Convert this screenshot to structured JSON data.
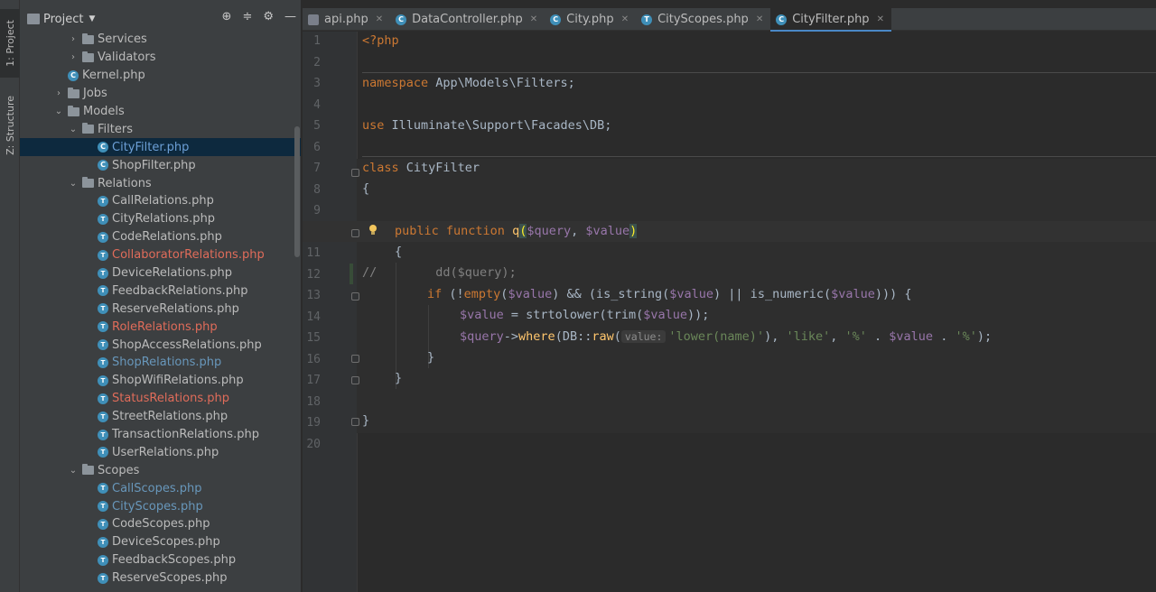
{
  "toolstrip": {
    "project_tab": "1: Project",
    "structure_tab": "Z: Structure"
  },
  "project_panel": {
    "title": "Project",
    "tools": [
      "crosshair-icon",
      "collapse-icon",
      "gear-icon",
      "minimize-icon"
    ],
    "tree": [
      {
        "label": "Services",
        "type": "folder",
        "depth": 3,
        "expanded": false
      },
      {
        "label": "Validators",
        "type": "folder",
        "depth": 3,
        "expanded": false
      },
      {
        "label": "Kernel.php",
        "type": "class",
        "depth": 3
      },
      {
        "label": "Jobs",
        "type": "folder",
        "depth": 2,
        "expanded": false
      },
      {
        "label": "Models",
        "type": "folder",
        "depth": 2,
        "expanded": true
      },
      {
        "label": "Filters",
        "type": "folder",
        "depth": 3,
        "expanded": true
      },
      {
        "label": "CityFilter.php",
        "type": "class",
        "depth": 4,
        "selected": true
      },
      {
        "label": "ShopFilter.php",
        "type": "class",
        "depth": 4
      },
      {
        "label": "Relations",
        "type": "folder",
        "depth": 3,
        "expanded": true
      },
      {
        "label": "CallRelations.php",
        "type": "trait",
        "depth": 4
      },
      {
        "label": "CityRelations.php",
        "type": "trait",
        "depth": 4
      },
      {
        "label": "CodeRelations.php",
        "type": "trait",
        "depth": 4
      },
      {
        "label": "CollaboratorRelations.php",
        "type": "trait",
        "depth": 4,
        "status": "red"
      },
      {
        "label": "DeviceRelations.php",
        "type": "trait",
        "depth": 4
      },
      {
        "label": "FeedbackRelations.php",
        "type": "trait",
        "depth": 4
      },
      {
        "label": "ReserveRelations.php",
        "type": "trait",
        "depth": 4
      },
      {
        "label": "RoleRelations.php",
        "type": "trait",
        "depth": 4,
        "status": "red"
      },
      {
        "label": "ShopAccessRelations.php",
        "type": "trait",
        "depth": 4
      },
      {
        "label": "ShopRelations.php",
        "type": "trait",
        "depth": 4,
        "status": "blue"
      },
      {
        "label": "ShopWifiRelations.php",
        "type": "trait",
        "depth": 4
      },
      {
        "label": "StatusRelations.php",
        "type": "trait",
        "depth": 4,
        "status": "red"
      },
      {
        "label": "StreetRelations.php",
        "type": "trait",
        "depth": 4
      },
      {
        "label": "TransactionRelations.php",
        "type": "trait",
        "depth": 4
      },
      {
        "label": "UserRelations.php",
        "type": "trait",
        "depth": 4
      },
      {
        "label": "Scopes",
        "type": "folder",
        "depth": 3,
        "expanded": true
      },
      {
        "label": "CallScopes.php",
        "type": "trait",
        "depth": 4,
        "status": "blue"
      },
      {
        "label": "CityScopes.php",
        "type": "trait",
        "depth": 4,
        "status": "blue"
      },
      {
        "label": "CodeScopes.php",
        "type": "trait",
        "depth": 4
      },
      {
        "label": "DeviceScopes.php",
        "type": "trait",
        "depth": 4
      },
      {
        "label": "FeedbackScopes.php",
        "type": "trait",
        "depth": 4
      },
      {
        "label": "ReserveScopes.php",
        "type": "trait",
        "depth": 4
      }
    ]
  },
  "tabs": [
    {
      "label": "api.php",
      "icon": "api",
      "active": false
    },
    {
      "label": "DataController.php",
      "icon": "class",
      "active": false
    },
    {
      "label": "City.php",
      "icon": "class",
      "active": false
    },
    {
      "label": "CityScopes.php",
      "icon": "trait",
      "active": false
    },
    {
      "label": "CityFilter.php",
      "icon": "class",
      "active": true
    }
  ],
  "editor": {
    "current_line": 10,
    "line_count": 20,
    "code": {
      "l1": "<?php",
      "l3_kw": "namespace",
      "l3_rest": " App\\Models\\Filters;",
      "l5_kw": "use",
      "l5_rest": " Illuminate\\Support\\Facades\\DB;",
      "l7_kw": "class",
      "l7_rest": " CityFilter",
      "l8": "{",
      "l10_kw": "public function",
      "l10_fn": "q",
      "l10_open": "(",
      "l10_p1": "$query",
      "l10_comma": ", ",
      "l10_p2": "$value",
      "l10_close": ")",
      "l11": "{",
      "l12_cmt": "//",
      "l12_rest": "        dd($query);",
      "l13_if": "if",
      "l13_a": " (!",
      "l13_empty": "empty",
      "l13_b": "(",
      "l13_v1": "$value",
      "l13_c": ") && (is_string(",
      "l13_v2": "$value",
      "l13_d": ") || is_numeric(",
      "l13_v3": "$value",
      "l13_e": "))) {",
      "l14_v": "$value",
      "l14_a": " = strtolower(trim(",
      "l14_v2": "$value",
      "l14_b": "));",
      "l15_v": "$query",
      "l15_a": "->",
      "l15_where": "where",
      "l15_b": "(DB::",
      "l15_raw": "raw",
      "l15_c": "(",
      "l15_hint": "value:",
      "l15_s1": "'lower(name)'",
      "l15_d": "), ",
      "l15_s2": "'like'",
      "l15_e": ", ",
      "l15_s3": "'%'",
      "l15_f": " . ",
      "l15_v2": "$value",
      "l15_g": " . ",
      "l15_s4": "'%'",
      "l15_h": ");",
      "l16": "}",
      "l17": "}",
      "l19": "}"
    }
  }
}
